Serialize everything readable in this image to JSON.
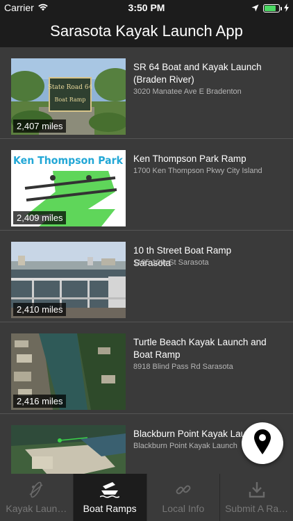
{
  "status_bar": {
    "carrier": "Carrier",
    "time": "3:50 PM",
    "battery_level": 0.8
  },
  "nav": {
    "title": "Sarasota Kayak Launch App"
  },
  "ramps": [
    {
      "title": "SR 64  Boat and Kayak Launch (Braden River)",
      "address": "3020 Manatee Ave E Bradenton",
      "distance": "2,407 miles",
      "image": "state-road-64-sign-photo"
    },
    {
      "title": "Ken Thompson Park Ramp",
      "address": "1700 Ken Thompson Pkwy City Island",
      "distance": "2,409 miles",
      "image": "ken-thompson-park-logo",
      "logo_text": "Ken Thompson Park"
    },
    {
      "title": "10 th Street Boat Ramp Sarasota",
      "address": "1105 10th St Sarasota",
      "distance": "2,410 miles",
      "image": "marina-docks-photo"
    },
    {
      "title": "Turtle Beach Kayak Launch and Boat Ramp",
      "address": "8918 Blind Pass Rd Sarasota",
      "distance": "2,416 miles",
      "image": "aerial-photo"
    },
    {
      "title": "Blackburn Point Kayak Launch",
      "address": "Blackburn Point Kayak Launch",
      "distance": "",
      "image": "aerial-map-photo"
    }
  ],
  "fab": {
    "icon": "map-pin-icon"
  },
  "tabs": [
    {
      "label": "Kayak Laun…",
      "icon": "kayak-icon",
      "active": false
    },
    {
      "label": "Boat Ramps",
      "icon": "boat-ramp-icon",
      "active": true
    },
    {
      "label": "Local Info",
      "icon": "link-icon",
      "active": false
    },
    {
      "label": "Submit A Ra…",
      "icon": "download-icon",
      "active": false
    }
  ],
  "colors": {
    "background": "#3a3a3a",
    "bar": "#1c1c1c",
    "battery": "#4cd964",
    "logo_green": "#5fd65a",
    "logo_text": "#22a7d6"
  }
}
